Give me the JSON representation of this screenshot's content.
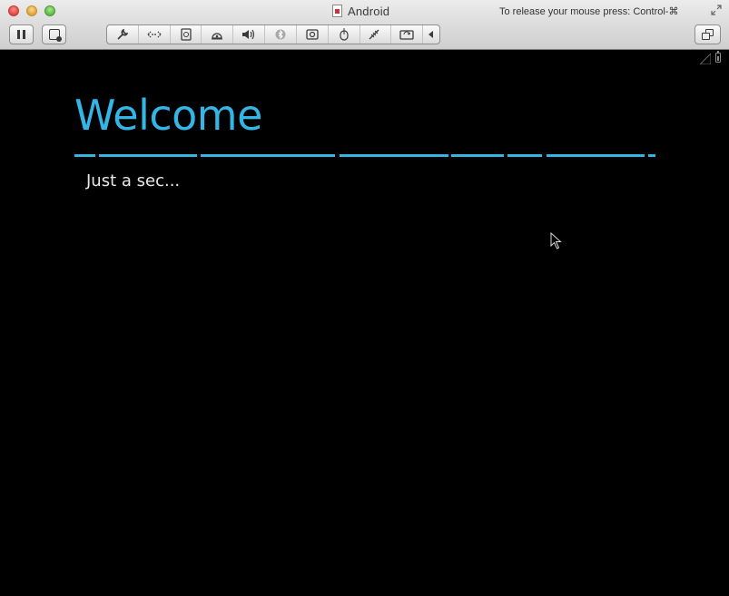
{
  "window": {
    "title": "Android",
    "release_hint": "To release your mouse press: Control-⌘"
  },
  "toolbar": {
    "pause_icon": "pause-icon",
    "snapshot_icon": "snapshot-icon",
    "device_icons": [
      "wrench-icon",
      "network-icon",
      "hard-disk-icon",
      "cd-dvd-icon",
      "sound-icon",
      "bluetooth-icon",
      "camera-icon",
      "usb-mouse-icon",
      "printer-icon",
      "shared-folder-icon",
      "collapse-arrow-icon"
    ],
    "window_icon": "window-mode-icon"
  },
  "guest": {
    "title": "Welcome",
    "subtitle": "Just a sec...",
    "accent_color": "#33b5e5",
    "background_color": "#000000"
  }
}
